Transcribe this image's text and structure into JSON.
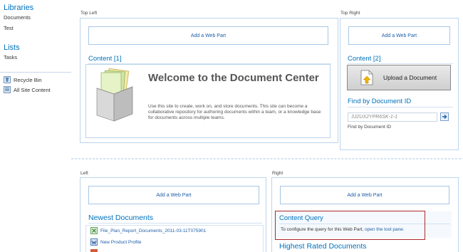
{
  "quick_launch": {
    "libraries": {
      "heading": "Libraries",
      "items": [
        {
          "label": "Documents"
        },
        {
          "label": "Test"
        }
      ]
    },
    "lists": {
      "heading": "Lists",
      "items": [
        {
          "label": "Tasks"
        }
      ]
    },
    "recycle_bin": {
      "label": "Recycle Bin",
      "icon": "recycle-bin-icon"
    },
    "all_site_content": {
      "label": "All Site Content",
      "icon": "site-content-icon"
    }
  },
  "zones": {
    "top_left": {
      "label": "Top Left",
      "add_web_part": "Add a Web Part",
      "content_title": "Content [1]",
      "welcome_title": "Welcome to the Document Center",
      "welcome_body": "Use this site to create, work on, and store documents. This site can become a collaborative repository for authoring documents within a team, or a knowledge base for documents across multiple teams."
    },
    "top_right": {
      "label": "Top Right",
      "add_web_part": "Add a Web Part",
      "content_title": "Content [2]",
      "upload_label": "Upload a Document",
      "find_title": "Find by Document ID",
      "doc_id_placeholder": "3J2UX2YPR6SK-1-1",
      "find_caption": "Find by Document ID"
    },
    "left": {
      "label": "Left",
      "add_web_part": "Add a Web Part",
      "newest_title": "Newest Documents",
      "documents": [
        {
          "label": "File_Plan_Report_Documents_2011-03-11T075901",
          "icon": "excel-file-icon"
        },
        {
          "label": "New Product Profile",
          "icon": "word-file-icon"
        }
      ]
    },
    "right": {
      "label": "Right",
      "add_web_part": "Add a Web Part",
      "content_query_title": "Content Query",
      "content_query_text": "To configure the query for this Web Part,",
      "content_query_link": "open the tool pane.",
      "highest_rated_title": "Highest Rated Documents"
    }
  },
  "colors": {
    "accent": "#0072bc",
    "link": "#1e5fa8",
    "highlight_border": "#b02a2a",
    "zone_border": "#bcd5ec"
  }
}
